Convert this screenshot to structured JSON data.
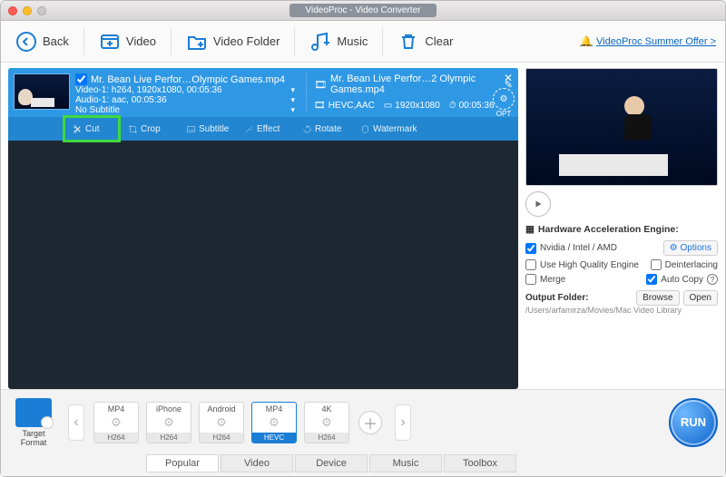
{
  "window": {
    "title": "VideoProc - Video Converter"
  },
  "toolbar": {
    "back": "Back",
    "video": "Video",
    "video_folder": "Video Folder",
    "music": "Music",
    "clear": "Clear",
    "offer": "VideoProc Summer Offer >"
  },
  "item": {
    "in_name": "Mr. Bean Live Perfor…Olympic Games.mp4",
    "video_line": "Video-1: h264, 1920x1080, 00:05:36",
    "audio_line": "Audio-1: aac, 00:05:36",
    "subtitle_line": "No Subtitle",
    "out_name": "Mr. Bean Live Perfor…2 Olympic Games.mp4",
    "out_codec": "HEVC,AAC",
    "out_res": "1920x1080",
    "out_dur": "00:05:36",
    "opt": "OPT"
  },
  "tools": {
    "cut": "Cut",
    "crop": "Crop",
    "subtitle": "Subtitle",
    "effect": "Effect",
    "rotate": "Rotate",
    "watermark": "Watermark"
  },
  "side": {
    "hw_title": "Hardware Acceleration Engine:",
    "nvidia": "Nvidia / Intel / AMD",
    "options": "Options",
    "hq": "Use High Quality Engine",
    "deint": "Deinterlacing",
    "merge": "Merge",
    "autocopy": "Auto Copy",
    "folder_label": "Output Folder:",
    "folder_path": "/Users/arfamirza/Movies/Mac Video Library",
    "browse": "Browse",
    "open": "Open"
  },
  "footer": {
    "target_format": "Target Format",
    "presets": [
      {
        "top": "MP4",
        "bottom": "H264",
        "selected": false
      },
      {
        "top": "iPhone",
        "bottom": "H264",
        "selected": false
      },
      {
        "top": "Android",
        "bottom": "H264",
        "selected": false
      },
      {
        "top": "MP4",
        "bottom": "HEVC",
        "selected": true
      },
      {
        "top": "4K",
        "bottom": "H264",
        "selected": false
      }
    ],
    "run": "RUN",
    "tabs": [
      "Popular",
      "Video",
      "Device",
      "Music",
      "Toolbox"
    ],
    "active_tab": 0
  }
}
